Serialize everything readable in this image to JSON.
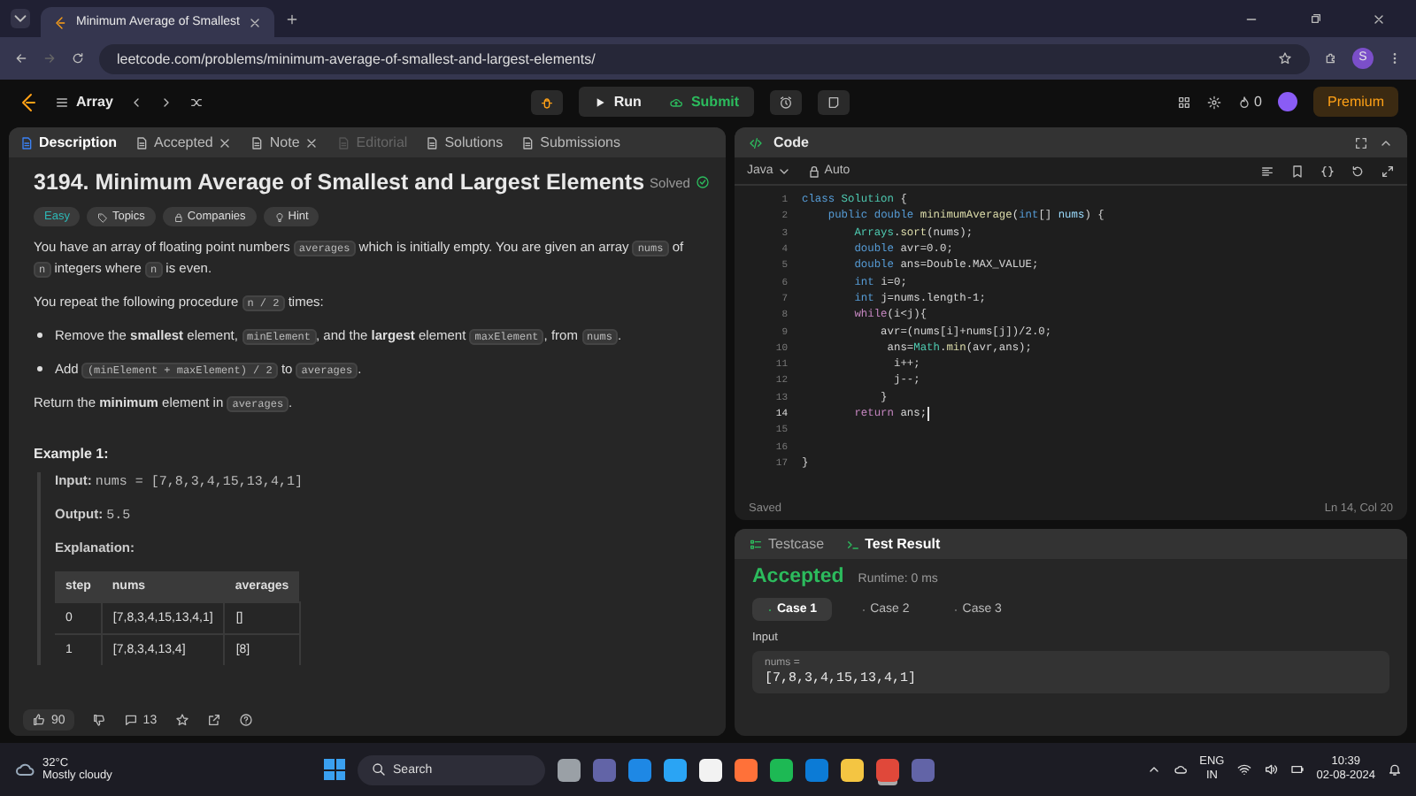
{
  "browser": {
    "tab_title": "Minimum Average of Smallest",
    "url": "leetcode.com/problems/minimum-average-of-smallest-and-largest-elements/",
    "profile": "S"
  },
  "nav": {
    "list": "Array",
    "run": "Run",
    "submit": "Submit",
    "streak": "0",
    "premium": "Premium"
  },
  "left_tabs": [
    {
      "label": "Description",
      "selected": true,
      "disabled": false,
      "closable": false
    },
    {
      "label": "Accepted",
      "selected": false,
      "disabled": false,
      "closable": true
    },
    {
      "label": "Note",
      "selected": false,
      "disabled": false,
      "closable": true
    },
    {
      "label": "Editorial",
      "selected": false,
      "disabled": true,
      "closable": false
    },
    {
      "label": "Solutions",
      "selected": false,
      "disabled": false,
      "closable": false
    },
    {
      "label": "Submissions",
      "selected": false,
      "disabled": false,
      "closable": false
    }
  ],
  "problem": {
    "title": "3194. Minimum Average of Smallest and Largest Elements",
    "status": "Solved",
    "difficulty": "Easy",
    "tags": [
      {
        "kind": "tag",
        "label": "Topics"
      },
      {
        "kind": "lock",
        "label": "Companies"
      },
      {
        "kind": "bulb",
        "label": "Hint"
      }
    ],
    "paragraphs": [
      {
        "kind": "p",
        "segments": [
          {
            "kind": "text",
            "text": "You have an array of floating point numbers "
          },
          {
            "kind": "code",
            "text": "averages"
          },
          {
            "kind": "text",
            "text": " which is initially empty. You are given an array "
          },
          {
            "kind": "code",
            "text": "nums"
          },
          {
            "kind": "text",
            "text": " of "
          },
          {
            "kind": "code",
            "text": "n"
          },
          {
            "kind": "text",
            "text": " integers where "
          },
          {
            "kind": "code",
            "text": "n"
          },
          {
            "kind": "text",
            "text": " is even."
          }
        ]
      },
      {
        "kind": "p",
        "segments": [
          {
            "kind": "text",
            "text": "You repeat the following procedure "
          },
          {
            "kind": "code",
            "text": "n / 2"
          },
          {
            "kind": "text",
            "text": " times:"
          }
        ]
      },
      {
        "kind": "bullet",
        "segments": [
          {
            "kind": "text",
            "text": "Remove the "
          },
          {
            "kind": "bold",
            "text": "smallest"
          },
          {
            "kind": "text",
            "text": " element, "
          },
          {
            "kind": "code",
            "text": "minElement"
          },
          {
            "kind": "text",
            "text": ", and the "
          },
          {
            "kind": "bold",
            "text": "largest"
          },
          {
            "kind": "text",
            "text": " element "
          },
          {
            "kind": "code",
            "text": "maxElement"
          },
          {
            "kind": "text",
            "text": ", from "
          },
          {
            "kind": "code",
            "text": "nums"
          },
          {
            "kind": "text",
            "text": "."
          }
        ]
      },
      {
        "kind": "bullet",
        "segments": [
          {
            "kind": "text",
            "text": "Add "
          },
          {
            "kind": "code",
            "text": "(minElement + maxElement) / 2"
          },
          {
            "kind": "text",
            "text": " to "
          },
          {
            "kind": "code",
            "text": "averages"
          },
          {
            "kind": "text",
            "text": "."
          }
        ]
      },
      {
        "kind": "p",
        "segments": [
          {
            "kind": "text",
            "text": "Return the "
          },
          {
            "kind": "bold",
            "text": "minimum"
          },
          {
            "kind": "text",
            "text": " element in "
          },
          {
            "kind": "code",
            "text": "averages"
          },
          {
            "kind": "text",
            "text": "."
          }
        ]
      }
    ],
    "example": {
      "heading": "Example 1:",
      "input_label": "Input:",
      "input": "nums = [7,8,3,4,15,13,4,1]",
      "output_label": "Output:",
      "output": "5.5",
      "explanation_label": "Explanation:",
      "columns": [
        "step",
        "nums",
        "averages"
      ],
      "rows": [
        [
          "0",
          "[7,8,3,4,15,13,4,1]",
          "[]"
        ],
        [
          "1",
          "[7,8,3,4,13,4]",
          "[8]"
        ]
      ]
    }
  },
  "footer": {
    "likes": "90",
    "comments": "13"
  },
  "code": {
    "title": "Code",
    "language": "Java",
    "mode": "Auto",
    "status": "Saved",
    "position": "Ln 14, Col 20",
    "lines": [
      {
        "num": "1",
        "current": false,
        "tokens": [
          {
            "kind": "kw",
            "text": "class "
          },
          {
            "kind": "type",
            "text": "Solution"
          },
          {
            "kind": "plain",
            "text": " {"
          }
        ]
      },
      {
        "num": "2",
        "current": false,
        "tokens": [
          {
            "kind": "kw",
            "text": "    public "
          },
          {
            "kind": "kw",
            "text": "double "
          },
          {
            "kind": "fn",
            "text": "minimumAverage"
          },
          {
            "kind": "plain",
            "text": "("
          },
          {
            "kind": "kw",
            "text": "int"
          },
          {
            "kind": "plain",
            "text": "[] "
          },
          {
            "kind": "var",
            "text": "nums"
          },
          {
            "kind": "plain",
            "text": ") {"
          }
        ]
      },
      {
        "num": "3",
        "current": false,
        "tokens": [
          {
            "kind": "type",
            "text": "        Arrays"
          },
          {
            "kind": "plain",
            "text": "."
          },
          {
            "kind": "fn",
            "text": "sort"
          },
          {
            "kind": "plain",
            "text": "(nums);"
          }
        ]
      },
      {
        "num": "4",
        "current": false,
        "tokens": [
          {
            "kind": "kw",
            "text": "        double "
          },
          {
            "kind": "plain",
            "text": "avr=0.0;"
          }
        ]
      },
      {
        "num": "5",
        "current": false,
        "tokens": [
          {
            "kind": "kw",
            "text": "        double "
          },
          {
            "kind": "plain",
            "text": "ans=Double.MAX_VALUE;"
          }
        ]
      },
      {
        "num": "6",
        "current": false,
        "tokens": [
          {
            "kind": "kw",
            "text": "        int "
          },
          {
            "kind": "plain",
            "text": "i=0;"
          }
        ]
      },
      {
        "num": "7",
        "current": false,
        "tokens": [
          {
            "kind": "kw",
            "text": "        int "
          },
          {
            "kind": "plain",
            "text": "j=nums.length-1;"
          }
        ]
      },
      {
        "num": "8",
        "current": false,
        "tokens": [
          {
            "kind": "ctl",
            "text": "        while"
          },
          {
            "kind": "plain",
            "text": "(i<j){"
          }
        ]
      },
      {
        "num": "9",
        "current": false,
        "tokens": [
          {
            "kind": "plain",
            "text": "            avr=(nums[i]+nums[j])/2.0;"
          }
        ]
      },
      {
        "num": "10",
        "current": false,
        "tokens": [
          {
            "kind": "plain",
            "text": "             ans="
          },
          {
            "kind": "type",
            "text": "Math"
          },
          {
            "kind": "plain",
            "text": "."
          },
          {
            "kind": "fn",
            "text": "min"
          },
          {
            "kind": "plain",
            "text": "(avr,ans);"
          }
        ]
      },
      {
        "num": "11",
        "current": false,
        "tokens": [
          {
            "kind": "plain",
            "text": "              i++;"
          }
        ]
      },
      {
        "num": "12",
        "current": false,
        "tokens": [
          {
            "kind": "plain",
            "text": "              j--;"
          }
        ]
      },
      {
        "num": "13",
        "current": false,
        "tokens": [
          {
            "kind": "plain",
            "text": "            }"
          }
        ]
      },
      {
        "num": "14",
        "current": true,
        "tokens": [
          {
            "kind": "ctl",
            "text": "        return "
          },
          {
            "kind": "plain",
            "text": "ans;"
          }
        ]
      },
      {
        "num": "15",
        "current": false
      },
      {
        "num": "16",
        "current": false
      },
      {
        "num": "17",
        "current": false,
        "tokens": [
          {
            "kind": "plain",
            "text": "}"
          }
        ]
      }
    ]
  },
  "test": {
    "tabs": [
      {
        "kind": "testcase",
        "label": "Testcase",
        "selected": false
      },
      {
        "kind": "result",
        "label": "Test Result",
        "selected": true
      }
    ],
    "verdict": "Accepted",
    "runtime": "Runtime: 0 ms",
    "cases": [
      {
        "label": "Case 1",
        "selected": true
      },
      {
        "label": "Case 2",
        "selected": false
      },
      {
        "label": "Case 3",
        "selected": false
      }
    ],
    "input_label": "Input",
    "var": "nums =",
    "value": "[7,8,3,4,15,13,4,1]"
  },
  "taskbar": {
    "temp": "32°C",
    "weather": "Mostly cloudy",
    "search": "Search",
    "apps": [
      {
        "kind": "taskview",
        "selected": false
      },
      {
        "kind": "teams",
        "selected": false
      },
      {
        "kind": "blue",
        "selected": false
      },
      {
        "kind": "copilot",
        "selected": false
      },
      {
        "kind": "store",
        "selected": false
      },
      {
        "kind": "firefox",
        "selected": false
      },
      {
        "kind": "spotify",
        "selected": false
      },
      {
        "kind": "edge",
        "selected": false
      },
      {
        "kind": "folder",
        "selected": false
      },
      {
        "kind": "chrome",
        "selected": true
      },
      {
        "kind": "teams",
        "selected": false
      }
    ],
    "lang": "ENG",
    "region": "IN",
    "time": "10:39",
    "date": "02-08-2024"
  }
}
